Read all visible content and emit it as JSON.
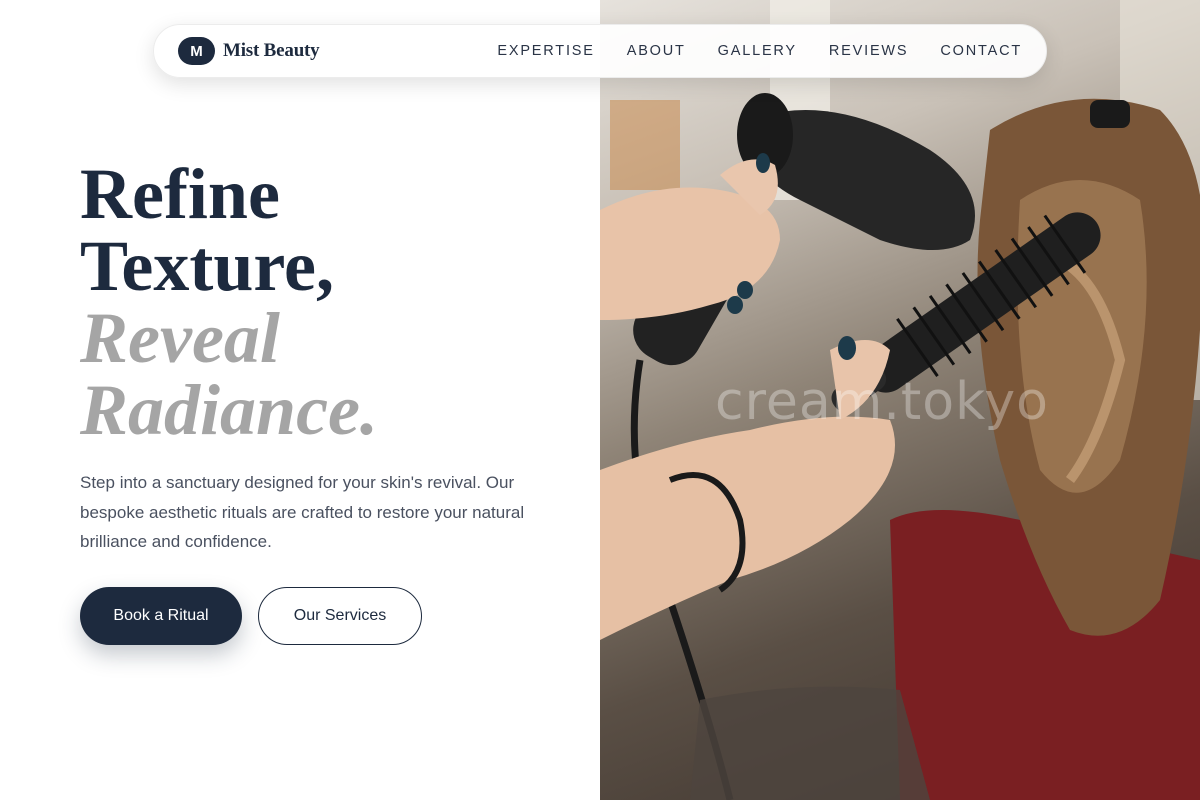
{
  "brand": {
    "mark": "M",
    "name": "Mist Beauty"
  },
  "nav": {
    "items": [
      {
        "label": "EXPERTISE"
      },
      {
        "label": "ABOUT"
      },
      {
        "label": "GALLERY"
      },
      {
        "label": "REVIEWS"
      },
      {
        "label": "CONTACT"
      }
    ]
  },
  "hero": {
    "headline_line1": "Refine",
    "headline_line2": "Texture,",
    "headline_accent1": "Reveal",
    "headline_accent2": "Radiance.",
    "description": "Step into a sanctuary designed for your skin's revival. Our bespoke aesthetic rituals are crafted to restore your natural brilliance and confidence.",
    "primary_cta": "Book a Ritual",
    "secondary_cta": "Our Services"
  },
  "photo": {
    "watermark": "cream.tokyo",
    "subject": "stylist blow-drying hair with round brush"
  },
  "colors": {
    "primary": "#1d2a3e",
    "accent_text": "#a5a5a5",
    "body_text": "#4a5160"
  }
}
